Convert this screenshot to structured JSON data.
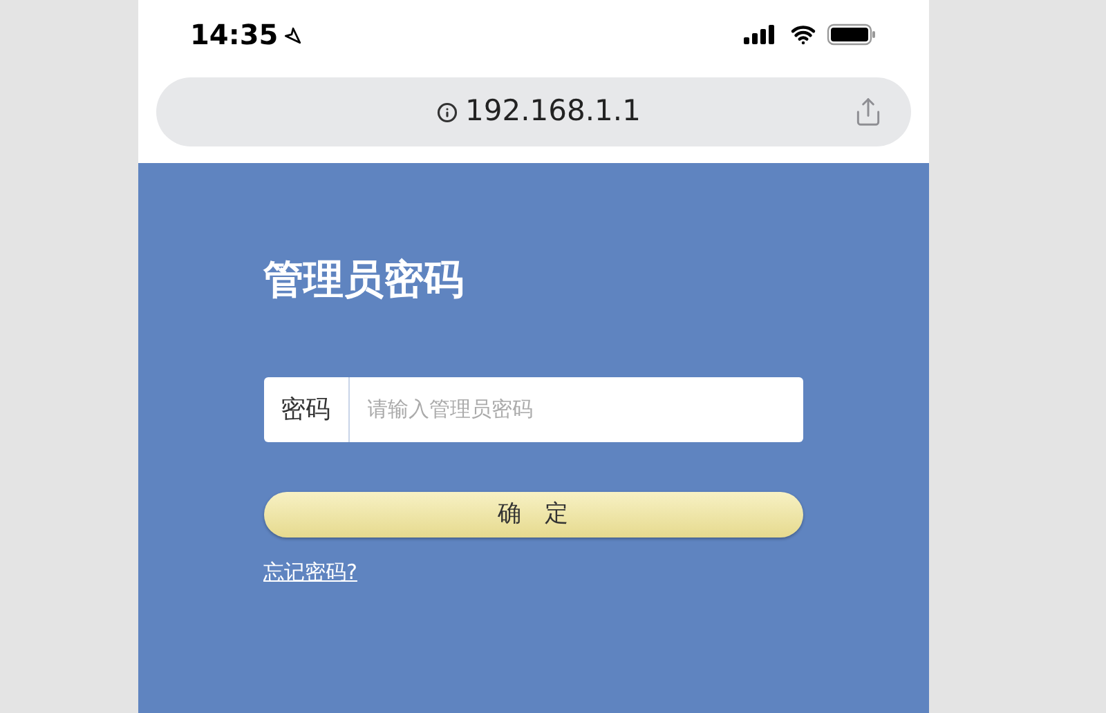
{
  "status_bar": {
    "time": "14:35"
  },
  "address_bar": {
    "url": "192.168.1.1"
  },
  "login": {
    "title": "管理员密码",
    "password_label": "密码",
    "password_placeholder": "请输入管理员密码",
    "confirm_button": "确　定",
    "forgot_link": "忘记密码?"
  }
}
